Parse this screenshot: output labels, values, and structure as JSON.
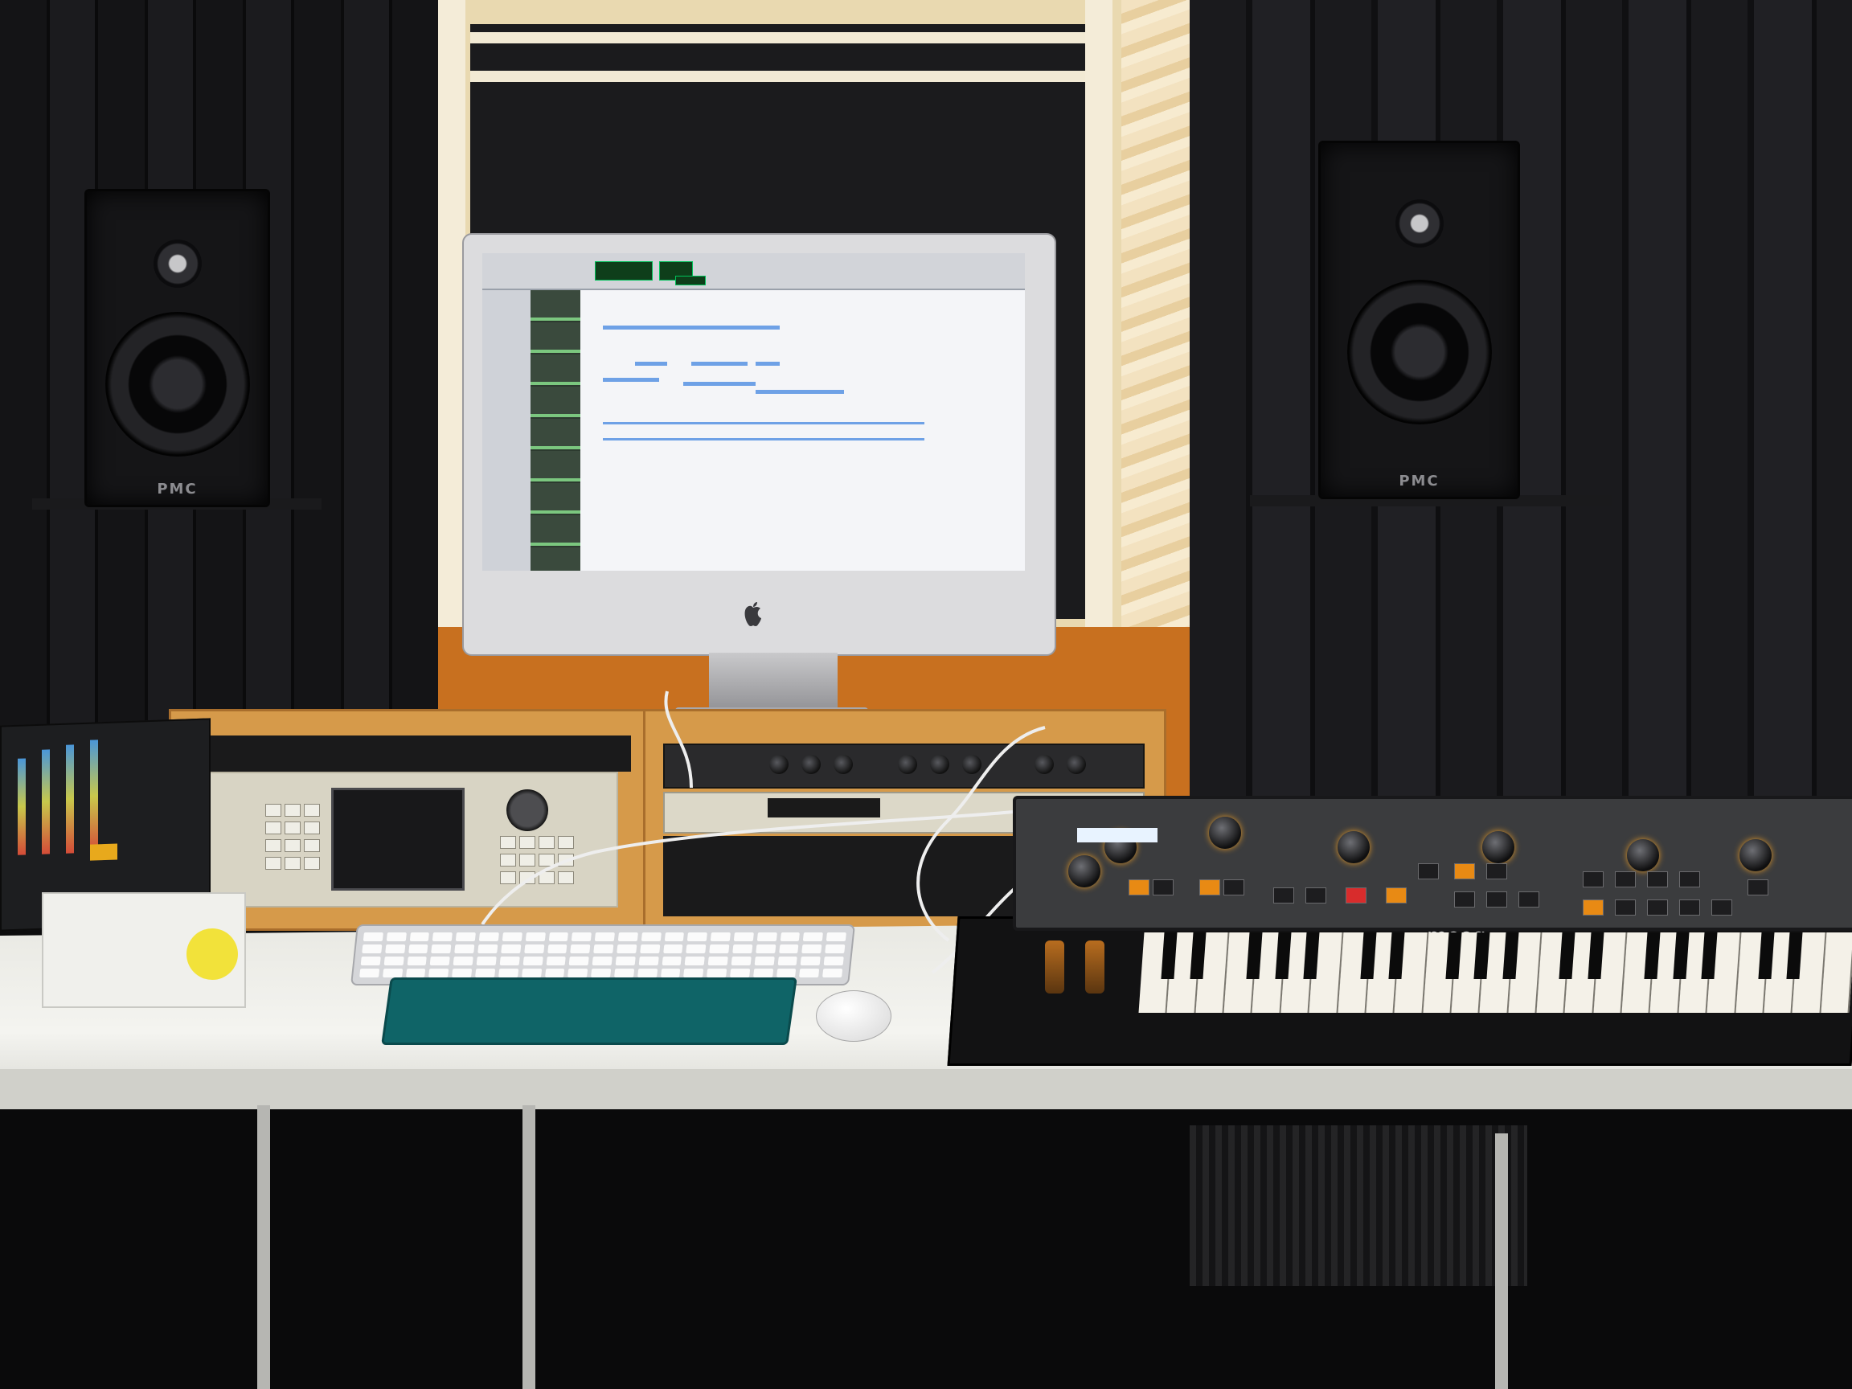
{
  "scene": {
    "description": "",
    "speaker_left": {
      "brand_label": "PMC"
    },
    "speaker_right": {
      "brand_label": "PMC"
    },
    "synth": {
      "brand_label": "moog"
    },
    "colors": {
      "wall": "#141416",
      "window_frame": "#e9d9b0",
      "orange_wall": "#c8701f",
      "desk": "#eeeeea",
      "tablet": "#0f6467",
      "led_amber": "#e88a14"
    },
    "icons": [
      "apple-logo-icon"
    ]
  }
}
